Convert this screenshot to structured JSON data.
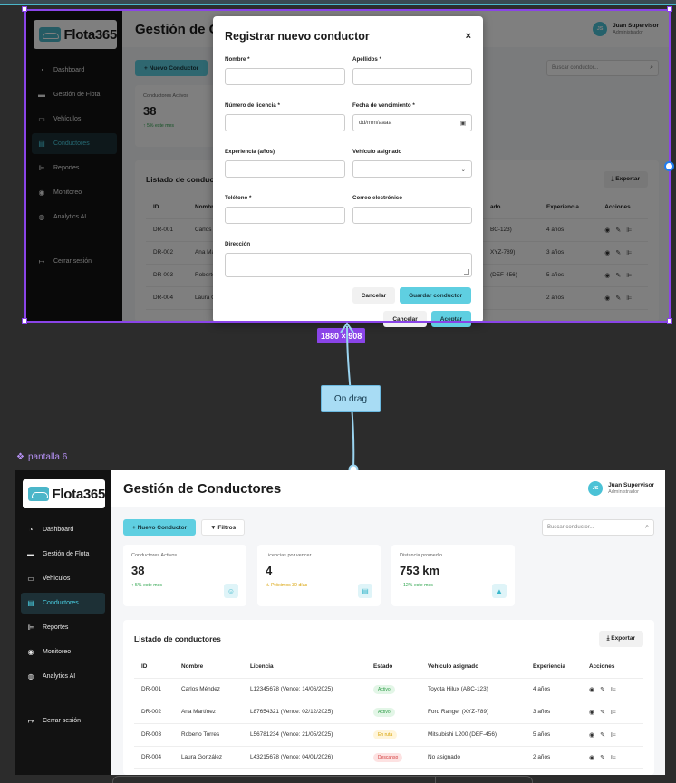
{
  "app": {
    "brand": "Flota365",
    "page_title": "Gestión de Conductores",
    "page_title_truncated": "Gestión de C",
    "user_name": "Juan Supervisor",
    "user_role": "Administrador",
    "user_initials": "JS"
  },
  "sidebar": {
    "items": [
      {
        "label": "Dashboard",
        "icon": "gauge-icon"
      },
      {
        "label": "Gestión de Flota",
        "icon": "truck-icon"
      },
      {
        "label": "Vehículos",
        "icon": "car-icon"
      },
      {
        "label": "Conductores",
        "icon": "id-card-icon"
      },
      {
        "label": "Reportes",
        "icon": "chart-icon"
      },
      {
        "label": "Monitoreo",
        "icon": "eye-icon"
      },
      {
        "label": "Analytics AI",
        "icon": "brain-icon"
      }
    ],
    "logout": "Cerrar sesión"
  },
  "toolbar": {
    "new_driver": "+ Nuevo Conductor",
    "filters": "Filtros",
    "search_placeholder": "Buscar conductor..."
  },
  "stats": [
    {
      "label": "Conductores Activos",
      "value": "38",
      "note": "↑ 5% este mes"
    },
    {
      "label": "Licencias por vencer",
      "value": "4",
      "note": "⚠ Próximos 30 días"
    },
    {
      "label": "Distancia promedio",
      "value": "753 km",
      "note": "↑ 12% este mes"
    }
  ],
  "list": {
    "title": "Listado de conductores",
    "title_truncated": "Listado de conduc",
    "export": "Exportar",
    "columns": [
      "ID",
      "Nombre",
      "Licencia",
      "Estado",
      "Vehículo asignado",
      "Experiencia",
      "Acciones"
    ],
    "rows": [
      {
        "id": "DR-001",
        "name": "Carlos Méndez",
        "name_cut": "Carlos M",
        "license": "L12345678 (Vence: 14/06/2025)",
        "status": "Activo",
        "vehicle": "Toyota Hilux (ABC-123)",
        "vehicle_cut": "BC-123)",
        "exp": "4 años"
      },
      {
        "id": "DR-002",
        "name": "Ana Martínez",
        "name_cut": "Ana Ma",
        "license": "L87654321 (Vence: 02/12/2025)",
        "status": "Activo",
        "vehicle": "Ford Ranger (XYZ-789)",
        "vehicle_cut": "XYZ-789)",
        "exp": "3 años"
      },
      {
        "id": "DR-003",
        "name": "Roberto Torres",
        "name_cut": "Roberto",
        "license": "L56781234 (Vence: 21/05/2025)",
        "status": "En ruta",
        "vehicle": "Mitsubishi L200 (DEF-456)",
        "vehicle_cut": "(DEF-456)",
        "exp": "5 años"
      },
      {
        "id": "DR-004",
        "name": "Laura González",
        "name_cut": "Laura G",
        "license": "L43215678 (Vence: 04/01/2026)",
        "status": "Descanso",
        "vehicle": "No asignado",
        "vehicle_cut": "",
        "exp": "2 años"
      }
    ],
    "top_vehicle_header": "ado"
  },
  "modal": {
    "title": "Registrar nuevo conductor",
    "close": "×",
    "fields": {
      "first_name": "Nombre *",
      "last_name": "Apellidos *",
      "license_number": "Número de licencia *",
      "expiry_date": "Fecha de vencimiento *",
      "expiry_placeholder": "dd/mm/aaaa",
      "experience": "Experiencia (años)",
      "vehicle": "Vehículo asignado",
      "phone": "Teléfono *",
      "email": "Correo electrónico",
      "address": "Dirección"
    },
    "cancel": "Cancelar",
    "save": "Guardar conductor",
    "cancel2": "Cancelar",
    "accept": "Aceptar"
  },
  "canvas": {
    "size_badge": "1880 × 908",
    "interaction_label": "On drag",
    "bottom_frame_label": "pantalla 6"
  },
  "colors": {
    "accent": "#5fcfe1",
    "selection": "#8a44e8",
    "sidebar_bg": "#121212"
  }
}
